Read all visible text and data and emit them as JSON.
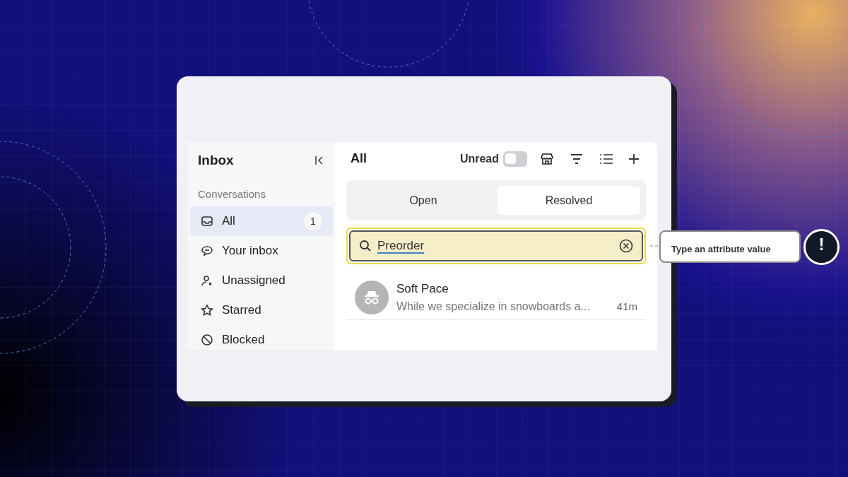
{
  "sidebar": {
    "title": "Inbox",
    "section": "Conversations",
    "items": [
      {
        "label": "All",
        "count": "1",
        "selected": true
      },
      {
        "label": "Your inbox",
        "selected": false
      },
      {
        "label": "Unassigned",
        "selected": false
      },
      {
        "label": "Starred",
        "selected": false
      },
      {
        "label": "Blocked",
        "selected": false
      }
    ]
  },
  "main": {
    "title": "All",
    "unread_toggle": {
      "label": "Unread",
      "on": false
    },
    "tabs": [
      {
        "label": "Open",
        "selected": false
      },
      {
        "label": "Resolved",
        "selected": true
      }
    ],
    "search": {
      "value": "Preorder"
    },
    "conversations": [
      {
        "name": "Soft Pace",
        "preview": "While we specialize in snowboards a...",
        "time": "41m"
      }
    ]
  },
  "tooltip": {
    "text": "Type an attribute value",
    "badge": "!"
  }
}
